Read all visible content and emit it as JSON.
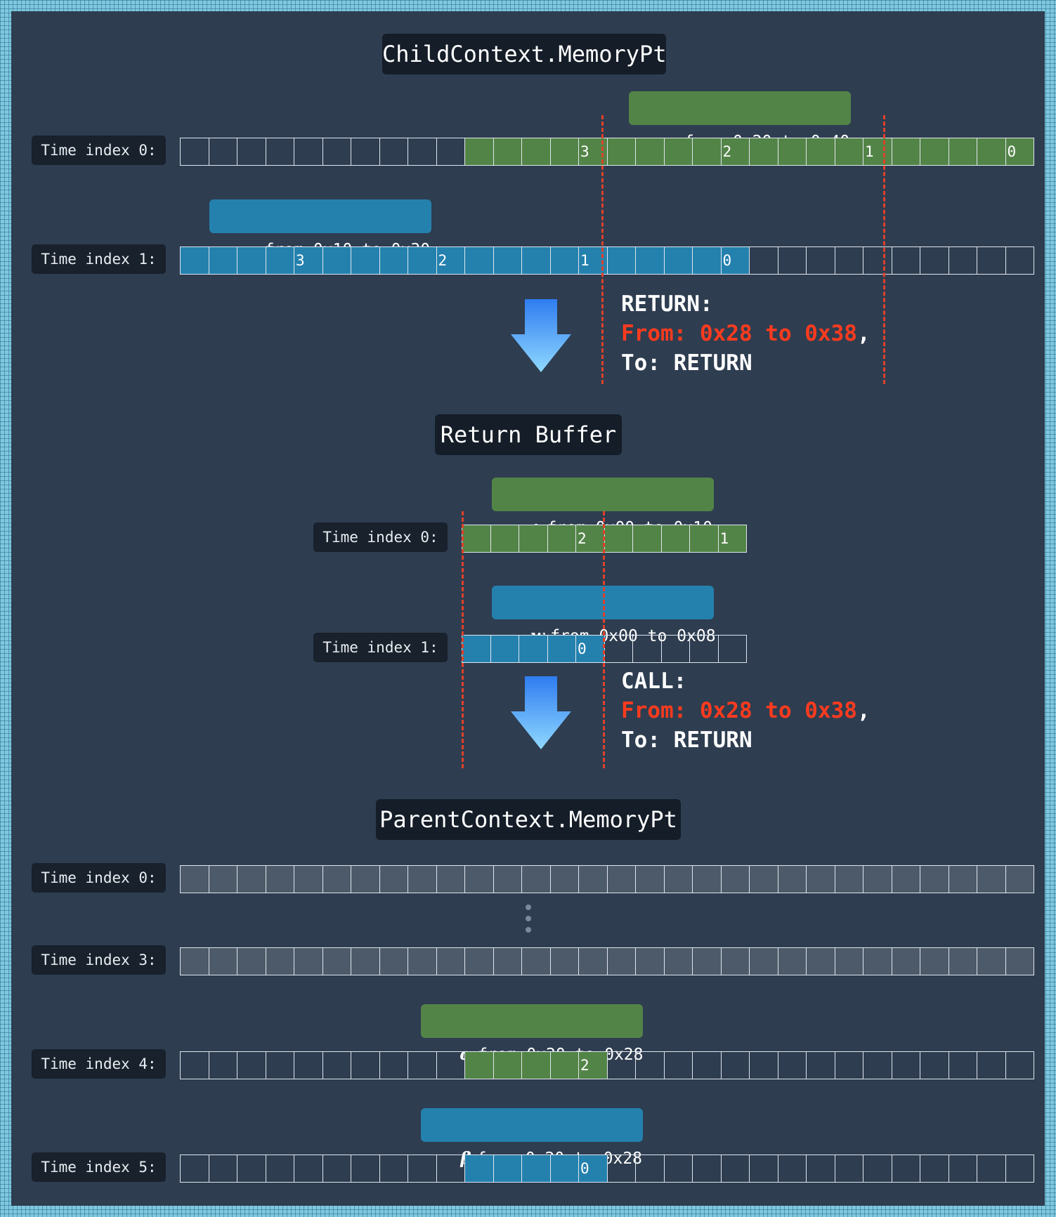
{
  "child": {
    "title": "ChildContext.MemoryPt",
    "label_x": {
      "var": "x",
      "text": "from 0x20 to 0x40"
    },
    "label_y": {
      "var": "y",
      "text": "from 0x10 to 0x30"
    },
    "row0": {
      "label": "Time index 0:",
      "cells": 30,
      "fill": {
        "from": 10,
        "to": 30,
        "color": "green"
      },
      "marks": [
        {
          "cell": 14,
          "text": "3"
        },
        {
          "cell": 19,
          "text": "2"
        },
        {
          "cell": 24,
          "text": "1"
        },
        {
          "cell": 29,
          "text": "0"
        }
      ]
    },
    "row1": {
      "label": "Time index 1:",
      "cells": 30,
      "fill": {
        "from": 0,
        "to": 20,
        "color": "blue"
      },
      "marks": [
        {
          "cell": 4,
          "text": "3"
        },
        {
          "cell": 9,
          "text": "2"
        },
        {
          "cell": 14,
          "text": "1"
        },
        {
          "cell": 19,
          "text": "0"
        }
      ]
    }
  },
  "return_note": {
    "head": "RETURN:",
    "from": "From: 0x28 to 0x38",
    "comma": ",",
    "to": "To: RETURN"
  },
  "buffer": {
    "title": "Return Buffer",
    "label_z": {
      "var": "z",
      "text": "from 0x00 to 0x10"
    },
    "label_w": {
      "var": "w",
      "text": "from 0x00 to 0x08"
    },
    "row0": {
      "label": "Time index 0:",
      "cells": 10,
      "fill": {
        "from": 0,
        "to": 10,
        "color": "green"
      },
      "marks": [
        {
          "cell": 4,
          "text": "2"
        },
        {
          "cell": 9,
          "text": "1"
        }
      ]
    },
    "row1": {
      "label": "Time index 1:",
      "cells": 10,
      "fill": {
        "from": 0,
        "to": 5,
        "color": "blue"
      },
      "marks": [
        {
          "cell": 4,
          "text": "0"
        }
      ]
    }
  },
  "call_note": {
    "head": "CALL:",
    "from": "From: 0x28 to 0x38",
    "comma": ",",
    "to": "To: RETURN"
  },
  "parent": {
    "title": "ParentContext.MemoryPt",
    "label_a": {
      "var": "α",
      "text": "from 0x20 to 0x28"
    },
    "label_b": {
      "var": "β",
      "text": "from 0x20 to 0x28"
    },
    "row0": {
      "label": "Time index 0:",
      "cells": 30,
      "fill": {
        "from": 0,
        "to": 30,
        "color": "gray"
      },
      "marks": []
    },
    "row3": {
      "label": "Time index 3:",
      "cells": 30,
      "fill": {
        "from": 0,
        "to": 30,
        "color": "gray"
      },
      "marks": []
    },
    "row4": {
      "label": "Time index 4:",
      "cells": 30,
      "fill": {
        "from": 10,
        "to": 15,
        "color": "green"
      },
      "marks": [
        {
          "cell": 14,
          "text": "2"
        }
      ]
    },
    "row5": {
      "label": "Time index 5:",
      "cells": 30,
      "fill": {
        "from": 10,
        "to": 15,
        "color": "blue"
      },
      "marks": [
        {
          "cell": 14,
          "text": "0"
        }
      ]
    }
  },
  "colors": {
    "green": "#538447",
    "blue": "#2481ae",
    "gray": "#4d5a69",
    "dash": "#e0402a",
    "highlight": "#ff3b1f"
  }
}
